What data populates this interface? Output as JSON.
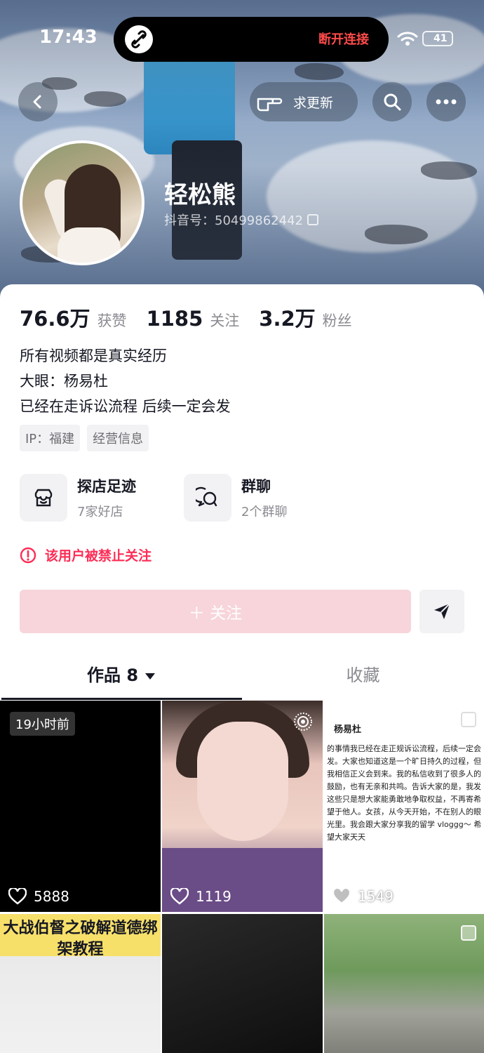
{
  "status_bar": {
    "time": "17:43",
    "connection_text": "断开连接",
    "battery": "41"
  },
  "top_bar": {
    "update_label": "求更新"
  },
  "profile": {
    "nickname": "轻松熊",
    "douyin_id": "抖音号：50499862442"
  },
  "stats": [
    {
      "num": "76.6万",
      "label": "获赞"
    },
    {
      "num": "1185",
      "label": "关注"
    },
    {
      "num": "3.2万",
      "label": "粉丝"
    }
  ],
  "bio": [
    "所有视频都是真实经历",
    "大眼：杨易杜",
    "已经在走诉讼流程 后续一定会发"
  ],
  "tags": [
    "IP：福建",
    "经营信息"
  ],
  "shortcuts": [
    {
      "title": "探店足迹",
      "sub": "7家好店",
      "icon": "store-icon"
    },
    {
      "title": "群聊",
      "sub": "2个群聊",
      "icon": "group-chat-icon"
    }
  ],
  "notice": "该用户被禁止关注",
  "follow_label": "＋ 关注",
  "tabs": {
    "works": "作品 8",
    "favorites": "收藏"
  },
  "grid": [
    {
      "likes": "5888",
      "badge": "19小时前"
    },
    {
      "likes": "1119"
    },
    {
      "likes": "1549",
      "preview_name": "杨易杜",
      "preview_text": "的事情我已经在走正规诉讼流程，后续一定会发。大家也知道这是一个旷日持久的过程，但我相信正义会到来。我的私信收到了很多人的鼓励，也有无亲和共鸣。告诉大家的是，我发这些只是想大家能勇敢地争取权益，不再寄希望于他人。女孩，从今天开始，不在别人的眼光里。我会跟大家分享我的留学 vloggg～ 希望大家天天"
    },
    {
      "title": "大战伯督之破解道德绑架教程"
    },
    {},
    {}
  ],
  "colors": {
    "accent": "#fe2c55",
    "follow_disabled": "#f7d5db"
  }
}
